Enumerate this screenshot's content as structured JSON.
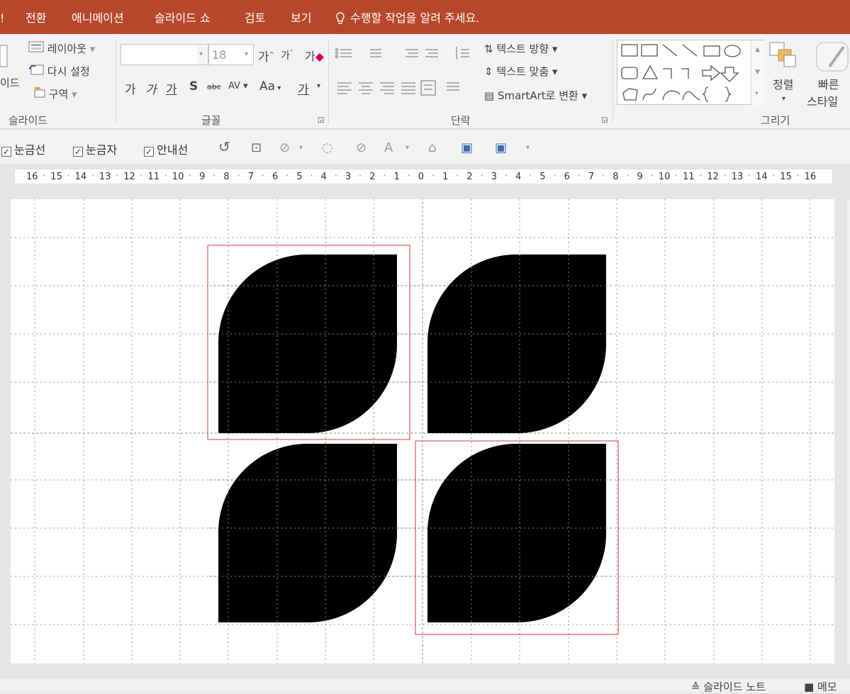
{
  "tabs": [
    "!",
    "전환",
    "애니메이션",
    "슬라이드 쇼",
    "검토",
    "보기"
  ],
  "tellme": "수행할 작업을 알려 주세요.",
  "ribbon": {
    "slides": {
      "layout": "레이아웃",
      "reset": "다시 설정",
      "section": "구역",
      "new_slide_partial": "이드",
      "group": "슬라이드"
    },
    "font": {
      "size": "18",
      "grow": "가",
      "shrink": "가",
      "clear": "가",
      "bold": "가",
      "italic": "가",
      "underline": "가",
      "shadow": "S",
      "strike": "abc",
      "spacing": "AV",
      "case": "Aa",
      "color": "가",
      "group": "글꼴"
    },
    "paragraph": {
      "text_dir": "텍스트 방향",
      "align_text": "텍스트 맞춤",
      "smartart": "SmartArt로 변환",
      "group": "단락"
    },
    "drawing": {
      "arrange": "정렬",
      "quick_styles_1": "빠른",
      "quick_styles_2": "스타일",
      "group": "그리기"
    }
  },
  "view": {
    "gridlines": "눈금선",
    "ruler": "눈금자",
    "guides": "안내선"
  },
  "ruler_labels": [
    "16",
    "15",
    "14",
    "13",
    "12",
    "11",
    "10",
    "9",
    "8",
    "7",
    "6",
    "5",
    "4",
    "3",
    "2",
    "1",
    "0",
    "1",
    "2",
    "3",
    "4",
    "5",
    "6",
    "7",
    "8",
    "9",
    "10",
    "11",
    "12",
    "13",
    "14",
    "15",
    "16"
  ],
  "status": {
    "notes": "슬라이드 노트",
    "comments": "메모"
  },
  "colors": {
    "tab_bar": "#b7472a",
    "selection": "#d9383a",
    "shape_fill": "#000000"
  }
}
